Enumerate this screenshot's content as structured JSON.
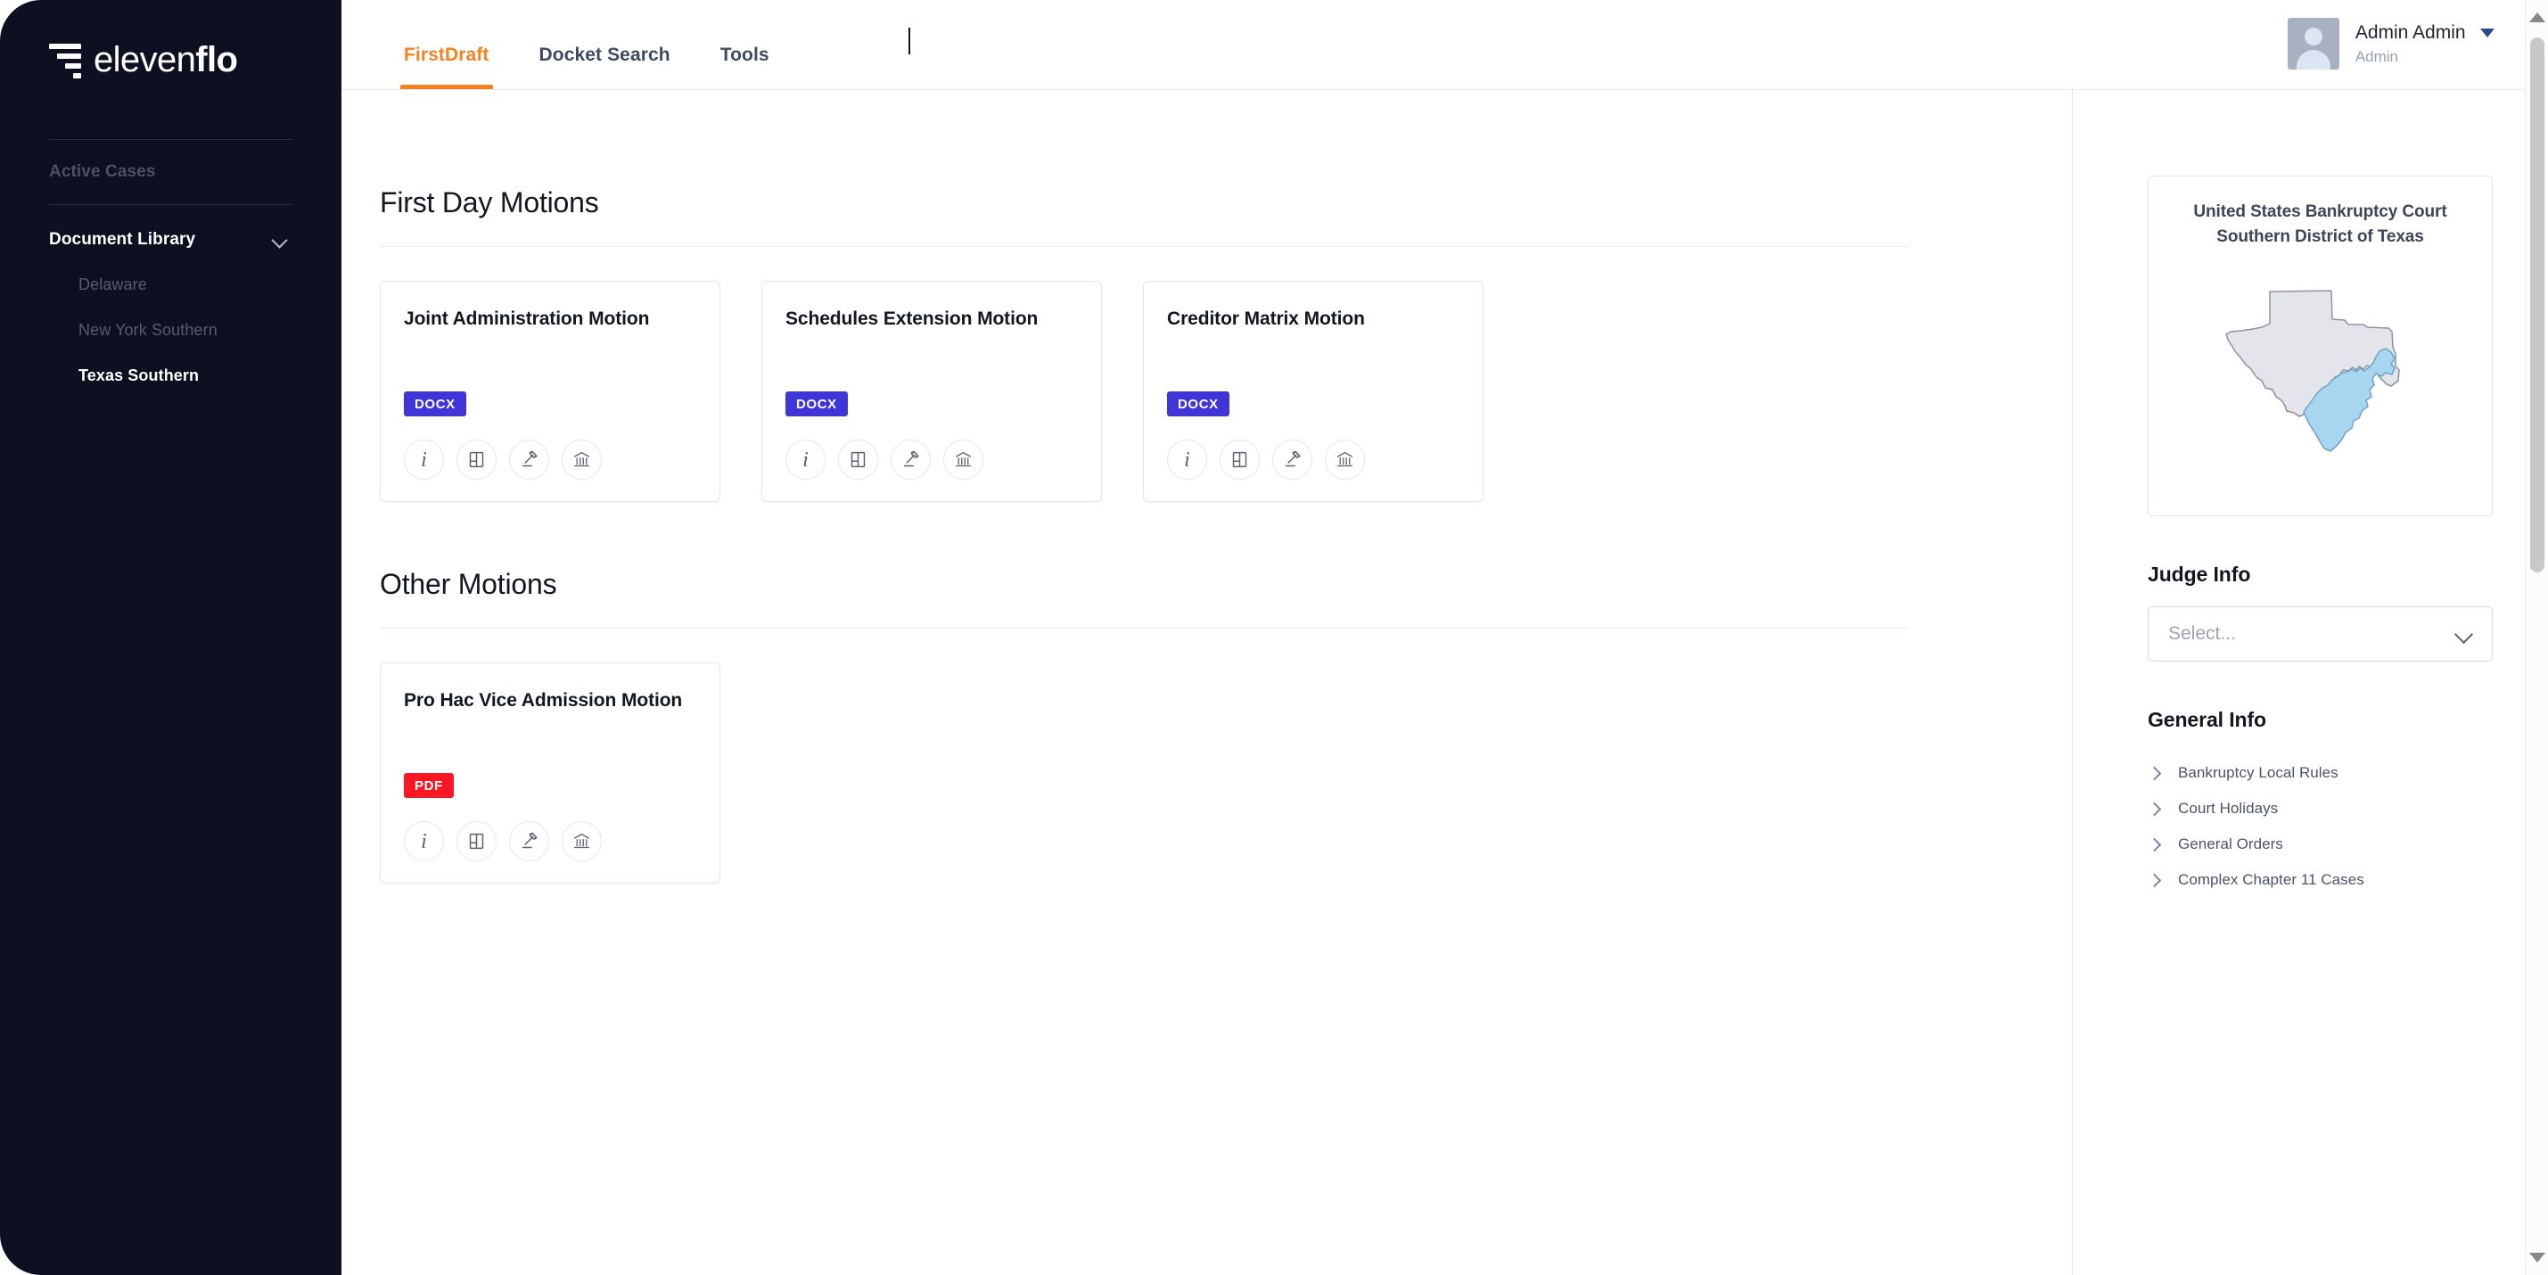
{
  "brand": {
    "name_light": "eleven",
    "name_bold": "flo",
    "logo_icon": "funnel-bars-icon"
  },
  "sidebar": {
    "section_label": "Active Cases",
    "library": {
      "label": "Document Library",
      "chevron_icon": "chevron-down-icon",
      "items": [
        {
          "label": "Delaware",
          "active": false
        },
        {
          "label": "New York Southern",
          "active": false
        },
        {
          "label": "Texas Southern",
          "active": true
        }
      ]
    }
  },
  "topbar": {
    "tabs": [
      {
        "label": "FirstDraft",
        "active": true
      },
      {
        "label": "Docket Search",
        "active": false
      },
      {
        "label": "Tools",
        "active": false
      }
    ],
    "user": {
      "name": "Admin Admin",
      "role": "Admin",
      "avatar_icon": "user-avatar-icon",
      "caret_icon": "caret-down-icon"
    }
  },
  "main": {
    "sections": [
      {
        "title": "First Day Motions",
        "cards": [
          {
            "title": "Joint Administration Motion",
            "format": "DOCX",
            "format_type": "docx",
            "actions": [
              {
                "icon": "info-icon",
                "name": "info"
              },
              {
                "icon": "book-icon",
                "name": "book"
              },
              {
                "icon": "gavel-icon",
                "name": "gavel"
              },
              {
                "icon": "courthouse-icon",
                "name": "courthouse"
              }
            ]
          },
          {
            "title": "Schedules Extension Motion",
            "format": "DOCX",
            "format_type": "docx",
            "actions": [
              {
                "icon": "info-icon",
                "name": "info"
              },
              {
                "icon": "book-icon",
                "name": "book"
              },
              {
                "icon": "gavel-icon",
                "name": "gavel"
              },
              {
                "icon": "courthouse-icon",
                "name": "courthouse"
              }
            ]
          },
          {
            "title": "Creditor Matrix Motion",
            "format": "DOCX",
            "format_type": "docx",
            "actions": [
              {
                "icon": "info-icon",
                "name": "info"
              },
              {
                "icon": "book-icon",
                "name": "book"
              },
              {
                "icon": "gavel-icon",
                "name": "gavel"
              },
              {
                "icon": "courthouse-icon",
                "name": "courthouse"
              }
            ]
          }
        ]
      },
      {
        "title": "Other Motions",
        "cards": [
          {
            "title": "Pro Hac Vice Admission Motion",
            "format": "PDF",
            "format_type": "pdf",
            "actions": [
              {
                "icon": "info-icon",
                "name": "info"
              },
              {
                "icon": "book-icon",
                "name": "book"
              },
              {
                "icon": "gavel-icon",
                "name": "gavel"
              },
              {
                "icon": "courthouse-icon",
                "name": "courthouse"
              }
            ]
          }
        ]
      }
    ]
  },
  "rightpanel": {
    "court": {
      "line1": "United States Bankruptcy Court",
      "line2": "Southern District of Texas",
      "map_icon": "texas-district-map",
      "map_base_color": "#e3e5ea",
      "map_highlight_color": "#a8d5ef"
    },
    "judge_info": {
      "heading": "Judge Info",
      "select_value": "Select...",
      "select_placeholder": "Select...",
      "chevron_icon": "chevron-down-icon"
    },
    "general_info": {
      "heading": "General Info",
      "links": [
        {
          "label": "Bankruptcy Local Rules",
          "icon": "chevron-right-icon"
        },
        {
          "label": "Court Holidays",
          "icon": "chevron-right-icon"
        },
        {
          "label": "General Orders",
          "icon": "chevron-right-icon"
        },
        {
          "label": "Complex Chapter 11 Cases",
          "icon": "chevron-right-icon"
        }
      ]
    }
  },
  "colors": {
    "sidebar_bg": "#0d1021",
    "accent_orange": "#f58220",
    "badge_docx": "#3f35d8",
    "badge_pdf": "#fb1724"
  },
  "scrollbar": {
    "up_icon": "scroll-up-arrow-icon",
    "down_icon": "scroll-down-arrow-icon"
  }
}
